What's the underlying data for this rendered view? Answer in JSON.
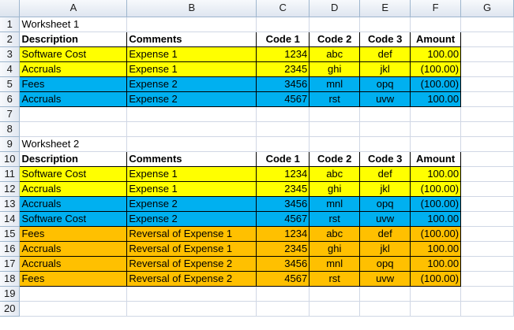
{
  "columns": [
    "A",
    "B",
    "C",
    "D",
    "E",
    "F",
    "G"
  ],
  "row_numbers": [
    "1",
    "2",
    "3",
    "4",
    "5",
    "6",
    "7",
    "8",
    "9",
    "10",
    "11",
    "12",
    "13",
    "14",
    "15",
    "16",
    "17",
    "18",
    "19",
    "20"
  ],
  "colors": {
    "yellow": "#ffff00",
    "blue": "#00b0f0",
    "orange": "#ffc000"
  },
  "worksheet1": {
    "title": "Worksheet 1",
    "headers": [
      "Description",
      "Comments",
      "Code 1",
      "Code 2",
      "Code 3",
      "Amount"
    ],
    "rows": [
      {
        "fill": "yellow",
        "cells": [
          "Software Cost",
          "Expense 1",
          "1234",
          "abc",
          "def",
          "100.00"
        ]
      },
      {
        "fill": "yellow",
        "cells": [
          "Accruals",
          "Expense 1",
          "2345",
          "ghi",
          "jkl",
          "(100.00)"
        ]
      },
      {
        "fill": "blue",
        "cells": [
          "Fees",
          "Expense 2",
          "3456",
          "mnl",
          "opq",
          "(100.00)"
        ]
      },
      {
        "fill": "blue",
        "cells": [
          "Accruals",
          "Expense 2",
          "4567",
          "rst",
          "uvw",
          "100.00"
        ]
      }
    ]
  },
  "worksheet2": {
    "title": "Worksheet 2",
    "headers": [
      "Description",
      "Comments",
      "Code 1",
      "Code 2",
      "Code 3",
      "Amount"
    ],
    "rows": [
      {
        "fill": "yellow",
        "cells": [
          "Software Cost",
          "Expense 1",
          "1234",
          "abc",
          "def",
          "100.00"
        ]
      },
      {
        "fill": "yellow",
        "cells": [
          "Accruals",
          "Expense 1",
          "2345",
          "ghi",
          "jkl",
          "(100.00)"
        ]
      },
      {
        "fill": "blue",
        "cells": [
          "Accruals",
          "Expense 2",
          "3456",
          "mnl",
          "opq",
          "(100.00)"
        ]
      },
      {
        "fill": "blue",
        "cells": [
          "Software Cost",
          "Expense 2",
          "4567",
          "rst",
          "uvw",
          "100.00"
        ]
      },
      {
        "fill": "orange",
        "cells": [
          "Fees",
          "Reversal of Expense 1",
          "1234",
          "abc",
          "def",
          "(100.00)"
        ]
      },
      {
        "fill": "orange",
        "cells": [
          "Accruals",
          "Reversal of Expense 1",
          "2345",
          "ghi",
          "jkl",
          "100.00"
        ]
      },
      {
        "fill": "orange",
        "cells": [
          "Accruals",
          "Reversal of Expense 2",
          "3456",
          "mnl",
          "opq",
          "100.00"
        ]
      },
      {
        "fill": "orange",
        "cells": [
          "Fees",
          "Reversal of Expense 2",
          "4567",
          "rst",
          "uvw",
          "(100.00)"
        ]
      }
    ]
  }
}
